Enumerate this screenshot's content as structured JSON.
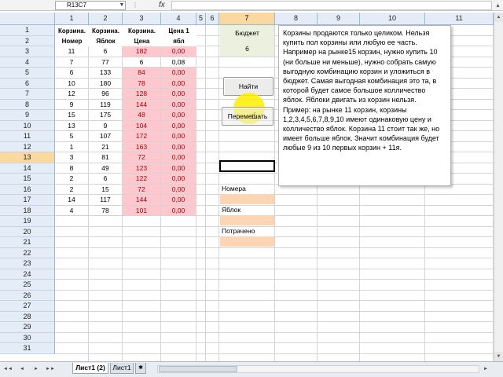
{
  "formula_bar": {
    "name_box": "R13C7",
    "name_box_arrow": "▼",
    "fx_dots": "⋮",
    "fx_label": "fx",
    "formula": "",
    "expand": "▴"
  },
  "columns": [
    "1",
    "2",
    "3",
    "4",
    "5",
    "6",
    "7",
    "8",
    "9",
    "10",
    "11"
  ],
  "rows": [
    "1",
    "2",
    "3",
    "4",
    "5",
    "6",
    "7",
    "8",
    "9",
    "10",
    "11",
    "12",
    "13",
    "14",
    "15",
    "16",
    "17",
    "18",
    "19",
    "20",
    "21",
    "22",
    "23",
    "24",
    "25",
    "26",
    "27",
    "28",
    "29",
    "30",
    "31"
  ],
  "table_headers": {
    "col1": "Корзина.\nНомер",
    "col2": "Корзина.\nЯблок",
    "col3": "Корзина.\nЦена",
    "col4": "Цена 1\nябл"
  },
  "table_rows": [
    [
      "11",
      "6",
      "182",
      "0,00"
    ],
    [
      "7",
      "77",
      "6",
      "0,08"
    ],
    [
      "6",
      "133",
      "84",
      "0,00"
    ],
    [
      "10",
      "180",
      "78",
      "0,00"
    ],
    [
      "12",
      "96",
      "128",
      "0,00"
    ],
    [
      "9",
      "119",
      "144",
      "0,00"
    ],
    [
      "15",
      "175",
      "48",
      "0,00"
    ],
    [
      "13",
      "9",
      "104",
      "0,00"
    ],
    [
      "5",
      "107",
      "172",
      "0,00"
    ],
    [
      "1",
      "21",
      "163",
      "0,00"
    ],
    [
      "3",
      "81",
      "72",
      "0,00"
    ],
    [
      "8",
      "49",
      "123",
      "0,00"
    ],
    [
      "2",
      "6",
      "122",
      "0,00"
    ],
    [
      "2",
      "15",
      "72",
      "0,00"
    ],
    [
      "14",
      "117",
      "144",
      "0,00"
    ],
    [
      "4",
      "78",
      "101",
      "0,00"
    ]
  ],
  "highlight_rows": [
    0,
    2,
    3,
    4,
    5,
    6,
    7,
    8,
    9,
    10,
    11,
    12,
    13,
    14,
    15
  ],
  "budget": {
    "label": "Бюджет",
    "value": "6"
  },
  "buttons": {
    "find": "Найти",
    "shuffle": "Перемешать"
  },
  "labels": {
    "numbers": "Номера",
    "apples": "Яблок",
    "spent": "Потрачено"
  },
  "textbox": "Корзины продаются только целиком. Нельзя купить пол корзины или любую ее часть. Например на рынке15 корзин, нужно купить 10 (ни больше ни меньше), нужно собрать самую выгодную комбинацию корзин и уложиться в бюджет. Самая выгодная комбинация это та, в которой будет самое большое колличество яблок. Яблоки двигать из корзин нельзя.\nПример: на рынке 11 корзин, корзины 1,2,3,4,5,6,7,8,9,10 имеют одинаковую цену и колличество яблок. Корзина 11 стоит так же, но имеет больше яблок. Значит комбинация будет любые 9 из 10 первых корзин + 11я.",
  "sheet_tabs": {
    "nav": [
      "◄◄",
      "◄",
      "►",
      "►►"
    ],
    "active": "Лист1 (2)",
    "other": "Лист1",
    "new": "✱"
  },
  "scroll": {
    "up": "▲",
    "down": "▼",
    "right": "►"
  },
  "colors": {
    "highlight_fill": "#ffc7ce",
    "highlight_text": "#9c0006",
    "selected_header": "#f9d99f",
    "budget_fill": "#ebf1de",
    "label_fill": "#fcd5b4"
  }
}
